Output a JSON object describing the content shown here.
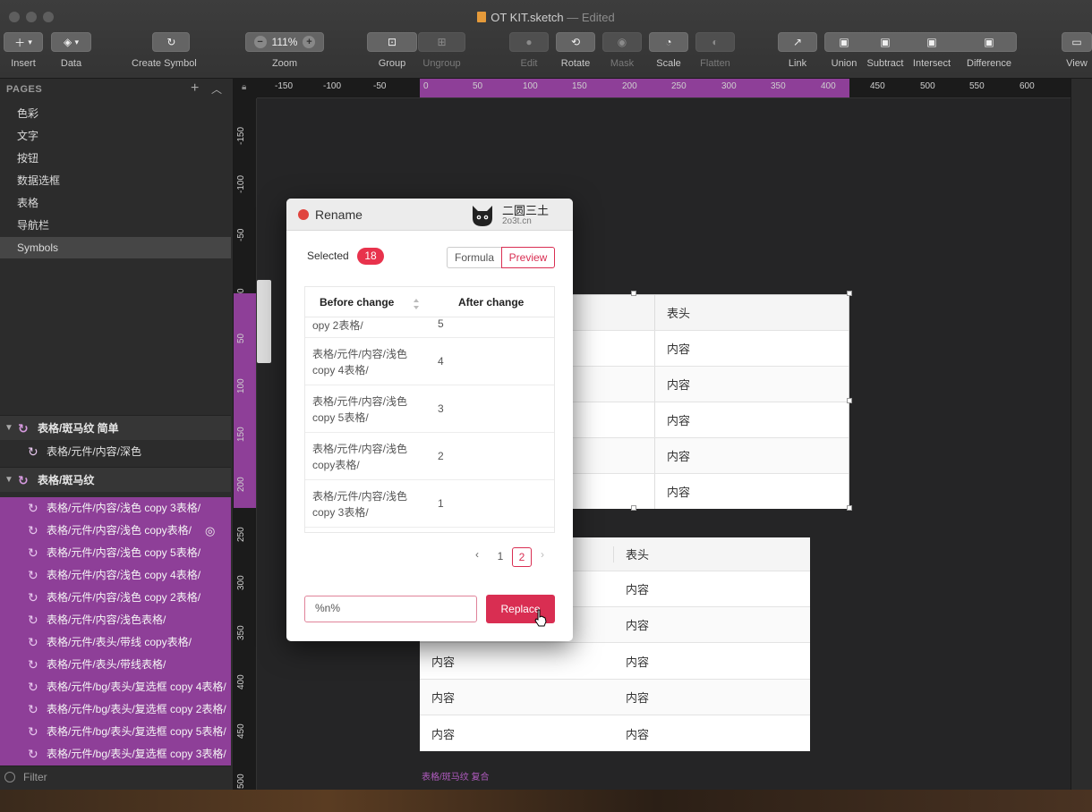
{
  "window": {
    "title": "OT KIT.sketch",
    "edited": "— Edited"
  },
  "toolbar": {
    "insert": "Insert",
    "data": "Data",
    "create_symbol": "Create Symbol",
    "zoom": "Zoom",
    "zoom_value": "111%",
    "group": "Group",
    "ungroup": "Ungroup",
    "edit": "Edit",
    "rotate": "Rotate",
    "mask": "Mask",
    "scale": "Scale",
    "flatten": "Flatten",
    "link": "Link",
    "union": "Union",
    "subtract": "Subtract",
    "intersect": "Intersect",
    "difference": "Difference",
    "view": "View"
  },
  "pages": {
    "header": "PAGES",
    "items": [
      "色彩",
      "文字",
      "按钮",
      "数据选框",
      "表格",
      "导航栏",
      "Symbols"
    ]
  },
  "layers": {
    "group1": "表格/斑马纹 简单",
    "group1_child": "表格/元件/内容/深色",
    "group2": "表格/斑马纹",
    "selected": [
      "表格/元件/内容/浅色 copy 3表格/",
      "表格/元件/内容/浅色 copy表格/",
      "表格/元件/内容/浅色 copy 5表格/",
      "表格/元件/内容/浅色 copy 4表格/",
      "表格/元件/内容/浅色 copy 2表格/",
      "表格/元件/内容/浅色表格/",
      "表格/元件/表头/带线 copy表格/",
      "表格/元件/表头/带线表格/",
      "表格/元件/bg/表头/复选框 copy 4表格/",
      "表格/元件/bg/表头/复选框 copy 2表格/",
      "表格/元件/bg/表头/复选框 copy 5表格/",
      "表格/元件/bg/表头/复选框 copy 3表格/"
    ],
    "filter": "Filter"
  },
  "ruler": {
    "top": [
      "-150",
      "-100",
      "-50",
      "0",
      "50",
      "100",
      "150",
      "200",
      "250",
      "300",
      "350",
      "400",
      "450",
      "500",
      "550",
      "600"
    ],
    "left": [
      "-150",
      "-100",
      "-50",
      "0",
      "50",
      "100",
      "150",
      "200",
      "250",
      "300",
      "350",
      "400",
      "450",
      "500"
    ]
  },
  "canvas": {
    "table1": {
      "header": "表头",
      "cell": "内容"
    },
    "table2": {
      "header": "表头",
      "cell": "内容"
    },
    "artboard_label": "表格/斑马纹 复合"
  },
  "dialog": {
    "title": "Rename",
    "brand_name": "二圆三土",
    "brand_url": "2o3t.cn",
    "selected_label": "Selected",
    "selected_count": "18",
    "tab_formula": "Formula",
    "tab_preview": "Preview",
    "col_before": "Before change",
    "col_after": "After change",
    "rows": [
      {
        "before": "opy 2表格/",
        "after": "5"
      },
      {
        "before": "表格/元件/内容/浅色 copy 4表格/",
        "after": "4"
      },
      {
        "before": "表格/元件/内容/浅色 copy 5表格/",
        "after": "3"
      },
      {
        "before": "表格/元件/内容/浅色 copy表格/",
        "after": "2"
      },
      {
        "before": "表格/元件/内容/浅色 copy 3表格/",
        "after": "1"
      }
    ],
    "page_1": "1",
    "page_2": "2",
    "pattern_value": "%n%",
    "replace_label": "Replace"
  },
  "colors": {
    "accent": "#d92e52",
    "selection": "#8e3f98"
  }
}
